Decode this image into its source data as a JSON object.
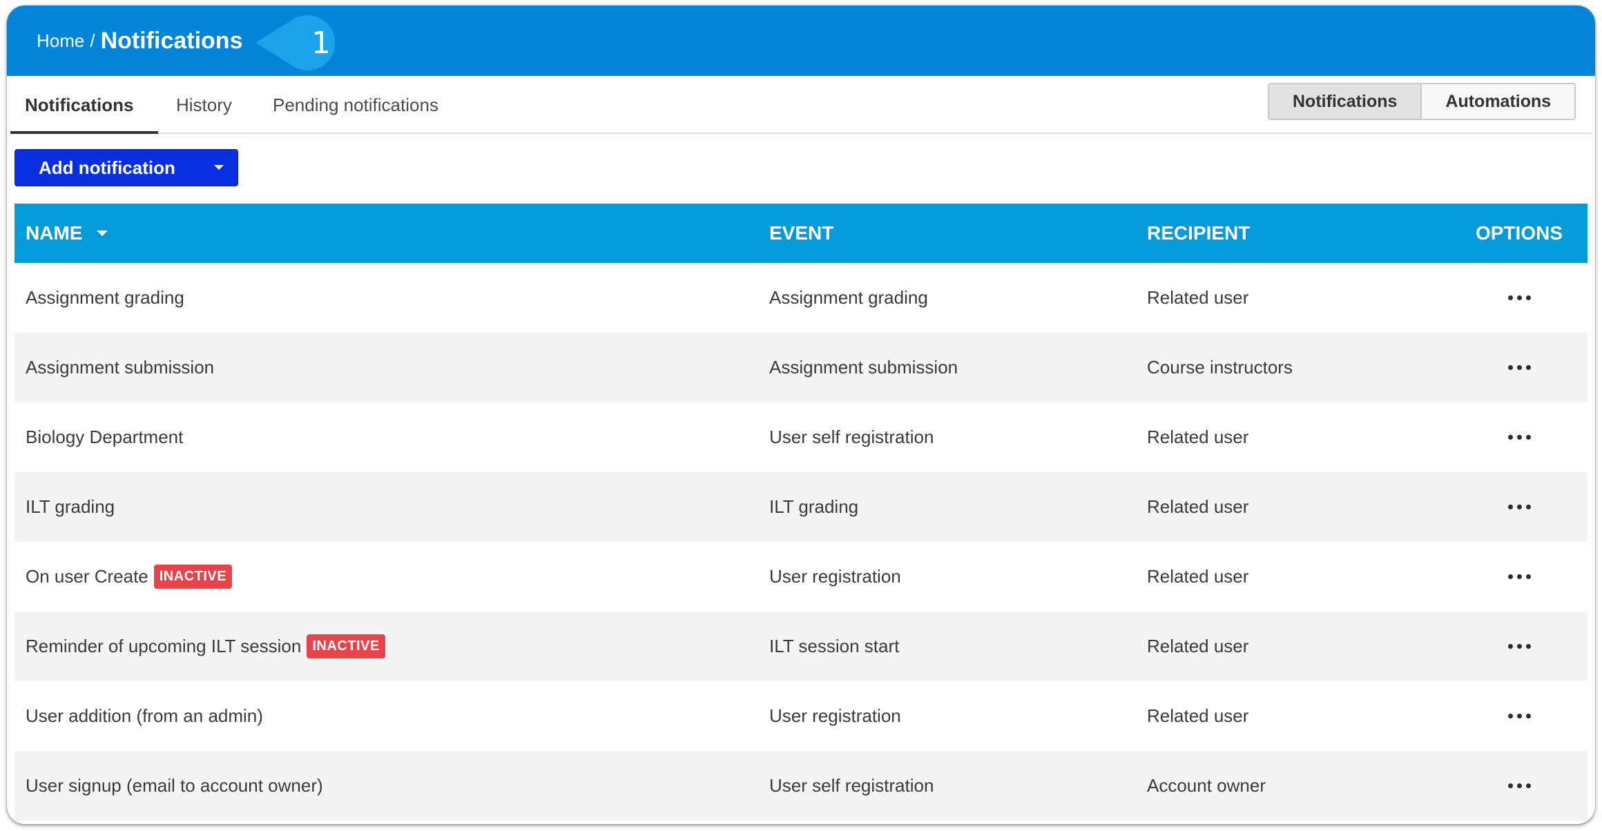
{
  "header": {
    "breadcrumb_home": "Home",
    "breadcrumb_sep": "/",
    "title": "Notifications",
    "callout_number": "1",
    "bg_color": "#0285d8"
  },
  "tabs": [
    {
      "label": "Notifications",
      "active": true
    },
    {
      "label": "History",
      "active": false
    },
    {
      "label": "Pending notifications",
      "active": false
    }
  ],
  "toggle": {
    "options": [
      "Notifications",
      "Automations"
    ],
    "selected": "Notifications"
  },
  "add_button": {
    "label": "Add notification",
    "icon": "caret-down-icon",
    "color": "#0a2fe0"
  },
  "table": {
    "header_color": "#049bdb",
    "columns": {
      "name": "NAME",
      "event": "EVENT",
      "recipient": "RECIPIENT",
      "options": "OPTIONS"
    },
    "sort_icon": "caret-down-icon",
    "rows": [
      {
        "name": "Assignment grading",
        "badge": "",
        "event": "Assignment grading",
        "recipient": "Related user"
      },
      {
        "name": "Assignment submission",
        "badge": "",
        "event": "Assignment submission",
        "recipient": "Course instructors"
      },
      {
        "name": "Biology Department",
        "badge": "",
        "event": "User self registration",
        "recipient": "Related user"
      },
      {
        "name": "ILT grading",
        "badge": "",
        "event": "ILT grading",
        "recipient": "Related user"
      },
      {
        "name": "On user Create",
        "badge": "INACTIVE",
        "event": "User registration",
        "recipient": "Related user"
      },
      {
        "name": "Reminder of upcoming ILT session",
        "badge": "INACTIVE",
        "event": "ILT session start",
        "recipient": "Related user"
      },
      {
        "name": "User addition (from an admin)",
        "badge": "",
        "event": "User registration",
        "recipient": "Related user"
      },
      {
        "name": "User signup (email to account owner)",
        "badge": "",
        "event": "User self registration",
        "recipient": "Account owner"
      }
    ],
    "options_icon": "more-horizontal-icon",
    "badge_color": "#e8424a"
  }
}
